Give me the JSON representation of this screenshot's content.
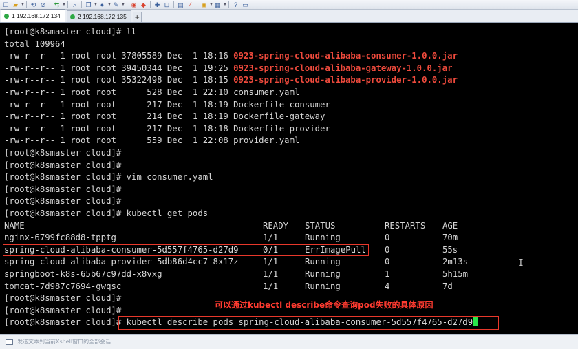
{
  "toolbar": {
    "icons": [
      "new-session",
      "open-folder",
      "caret",
      "sep",
      "reconnect",
      "disconnect",
      "sep",
      "transfer",
      "caret",
      "sep",
      "find",
      "sep",
      "copy",
      "caret",
      "globe",
      "caret",
      "compose",
      "caret",
      "sep",
      "xftp",
      "xshell-logo",
      "sep",
      "layout",
      "lock",
      "sep",
      "keyboard",
      "script",
      "sep",
      "window",
      "caret",
      "tile",
      "caret",
      "sep",
      "help",
      "chat"
    ]
  },
  "tabs": [
    {
      "label": "1 192.168.172.134",
      "dot_color": "#2ea845",
      "active": true
    },
    {
      "label": "2 192.168.172.135",
      "dot_color": "#2ea845",
      "active": false
    }
  ],
  "tab_add_label": "+",
  "terminal": {
    "lines": [
      "[root@k8smaster cloud]# ll",
      "total 109964",
      "-rw-r--r-- 1 root root 37805589 Dec  1 18:16 ",
      "-rw-r--r-- 1 root root 39450344 Dec  1 19:25 ",
      "-rw-r--r-- 1 root root 35322498 Dec  1 18:15 ",
      "-rw-r--r-- 1 root root      528 Dec  1 22:10 consumer.yaml",
      "-rw-r--r-- 1 root root      217 Dec  1 18:19 Dockerfile-consumer",
      "-rw-r--r-- 1 root root      214 Dec  1 18:19 Dockerfile-gateway",
      "-rw-r--r-- 1 root root      217 Dec  1 18:18 Dockerfile-provider",
      "-rw-r--r-- 1 root root      559 Dec  1 22:08 provider.yaml",
      "[root@k8smaster cloud]#",
      "[root@k8smaster cloud]#",
      "[root@k8smaster cloud]# vim consumer.yaml",
      "[root@k8smaster cloud]#",
      "[root@k8smaster cloud]#",
      "[root@k8smaster cloud]# kubectl get pods"
    ],
    "jar_files": [
      "0923-spring-cloud-alibaba-consumer-1.0.0.jar",
      "0923-spring-cloud-alibaba-gateway-1.0.0.jar",
      "0923-spring-cloud-alibaba-provider-1.0.0.jar"
    ],
    "pods_header": [
      "NAME",
      "READY",
      "STATUS",
      "RESTARTS",
      "AGE"
    ],
    "pods": [
      [
        "nginx-6799fc88d8-tpptg",
        "1/1",
        "Running",
        "0",
        "70m"
      ],
      [
        "spring-cloud-alibaba-consumer-5d557f4765-d27d9",
        "0/1",
        "ErrImagePull",
        "0",
        "55s"
      ],
      [
        "spring-cloud-alibaba-provider-5db86d4cc7-8x17z",
        "1/1",
        "Running",
        "0",
        "2m13s"
      ],
      [
        "springboot-k8s-65b67c97dd-x8vxg",
        "1/1",
        "Running",
        "1",
        "5h15m"
      ],
      [
        "tomcat-7d987c7694-gwqsc",
        "1/1",
        "Running",
        "4",
        "7d"
      ]
    ],
    "after_lines": [
      "[root@k8smaster cloud]#",
      "[root@k8smaster cloud]#",
      "[root@k8smaster cloud]# kubectl describe pods spring-cloud-alibaba-consumer-5d557f4765-d27d9"
    ],
    "annotation": "可以通过kubectl describe命令查询pod失败的具体原因",
    "colors": {
      "text": "#d6d6d6",
      "jar": "#ee4a3c",
      "annotation": "#ff3b30",
      "cursor": "#28e64a",
      "highlight_box": "#e8382b"
    }
  },
  "inputbar": {
    "placeholder": "发送文本到当前Xshell窗口的全部会话"
  }
}
